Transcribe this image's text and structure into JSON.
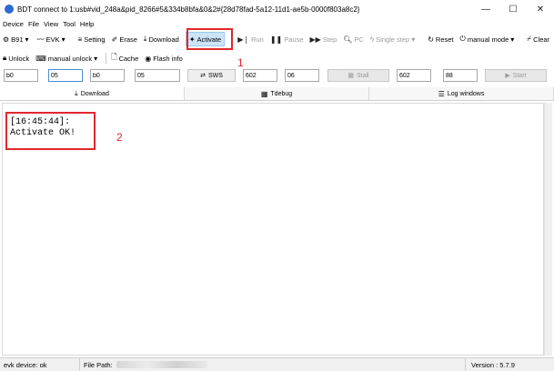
{
  "window": {
    "title": "BDT connect to 1:usb#vid_248a&pid_8266#5&334b8bfa&0&2#{28d78fad-5a12-11d1-ae5b-0000f803a8c2}",
    "minimize": "—",
    "maximize": "☐",
    "close": "✕"
  },
  "menu": [
    "Device",
    "File",
    "View",
    "Tool",
    "Help"
  ],
  "toolbar": {
    "chip": "B91",
    "board": "EVK",
    "setting": "Setting",
    "erase": "Erase",
    "download": "Download",
    "activate": "Activate",
    "run": "Run",
    "pause": "Pause",
    "step": "Step",
    "pc": "PC",
    "single_step": "Single step",
    "reset": "Reset",
    "manual_mode": "manual mode",
    "clear": "Clear"
  },
  "toolbar2": {
    "unlock": "Unlock",
    "manual_unlock": "manual unlock",
    "cache": "Cache",
    "flash_info": "Flash info"
  },
  "fields": {
    "f1": "b0",
    "f2": "05",
    "f3": "b0",
    "f4": "05",
    "sws": "SWS",
    "f5": "602",
    "f6": "06",
    "stall": "Stall",
    "f7": "602",
    "f8": "88",
    "start": "Start"
  },
  "tabs": [
    "Download",
    "Tdebug",
    "Log windows"
  ],
  "log": {
    "time": "[16:45:44]:",
    "message": "Activate OK!"
  },
  "annotations": {
    "one": "1",
    "two": "2"
  },
  "status": {
    "device": "evk device: ok",
    "file_path_label": "File Path:",
    "version": "Version : 5.7.9"
  },
  "colors": {
    "highlight": "#e0282c",
    "active_button": "#cce4f7"
  }
}
